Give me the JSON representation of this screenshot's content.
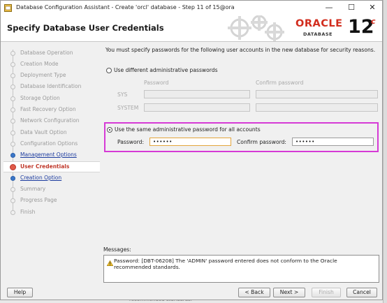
{
  "window": {
    "title": "Database Configuration Assistant - Create 'orcl' database - Step 11 of 15@ora",
    "minimize": "—",
    "maximize": "☐",
    "close": "✕"
  },
  "header": {
    "page_title": "Specify Database User Credentials",
    "brand": "ORACLE",
    "brand_sub": "DATABASE",
    "version": "12",
    "version_suffix": "c"
  },
  "nav": {
    "items": [
      {
        "label": "Database Operation",
        "state": "done"
      },
      {
        "label": "Creation Mode",
        "state": "done"
      },
      {
        "label": "Deployment Type",
        "state": "done"
      },
      {
        "label": "Database Identification",
        "state": "done"
      },
      {
        "label": "Storage Option",
        "state": "done"
      },
      {
        "label": "Fast Recovery Option",
        "state": "done"
      },
      {
        "label": "Network Configuration",
        "state": "done"
      },
      {
        "label": "Data Vault Option",
        "state": "done"
      },
      {
        "label": "Configuration Options",
        "state": "done"
      },
      {
        "label": "Management Options",
        "state": "link"
      },
      {
        "label": "User Credentials",
        "state": "current"
      },
      {
        "label": "Creation Option",
        "state": "link"
      },
      {
        "label": "Summary",
        "state": "pending"
      },
      {
        "label": "Progress Page",
        "state": "pending"
      },
      {
        "label": "Finish",
        "state": "pending"
      }
    ]
  },
  "main": {
    "intro": "You must specify passwords for the following user accounts in the new database for security reasons.",
    "different": {
      "label": "Use different administrative passwords",
      "col_password": "Password",
      "col_confirm": "Confirm password",
      "rows": [
        "SYS",
        "SYSTEM"
      ]
    },
    "same": {
      "label": "Use the same administrative password for all accounts",
      "password_label": "Password:",
      "password_value": "••••••",
      "confirm_label": "Confirm password:",
      "confirm_value": "••••••"
    }
  },
  "messages": {
    "label": "Messages:",
    "text": "Password: [DBT-06208] The 'ADMIN' password entered does not conform to the Oracle recommended standards."
  },
  "buttons": {
    "help": "Help",
    "back": "< Back",
    "next": "Next >",
    "finish": "Finish",
    "cancel": "Cancel"
  },
  "background_fragment": "recommended standards."
}
